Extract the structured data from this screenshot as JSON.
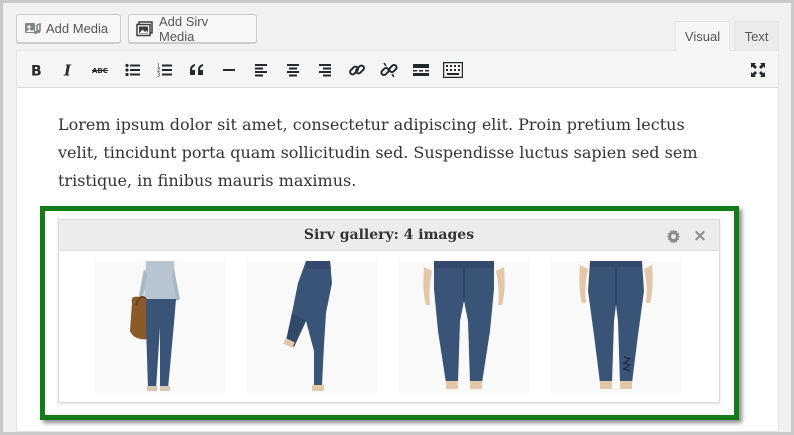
{
  "media_buttons": {
    "add_media": "Add Media",
    "add_sirv_media": "Add Sirv Media"
  },
  "tabs": {
    "visual": "Visual",
    "text": "Text",
    "active": "Visual"
  },
  "toolbar": {
    "buttons": [
      "bold-icon",
      "italic-icon",
      "strikethrough-icon",
      "bullet-list-icon",
      "numbered-list-icon",
      "blockquote-icon",
      "horizontal-rule-icon",
      "align-left-icon",
      "align-center-icon",
      "align-right-icon",
      "insert-link-icon",
      "remove-link-icon",
      "read-more-icon",
      "toolbar-toggle-icon",
      "fullscreen-icon"
    ]
  },
  "content": {
    "paragraph": "Lorem ipsum dolor sit amet, consectetur adipiscing elit. Proin pretium lectus velit, tincidunt porta quam sollicitudin sed. Suspendisse luctus sapien sed sem tristique, in finibus mauris maximus."
  },
  "gallery": {
    "title": "Sirv gallery: 4 images",
    "close_glyph": "×",
    "image_count": 4,
    "images": [
      "jeans-front-full-outfit",
      "jeans-side-view",
      "jeans-front-view",
      "jeans-back-view"
    ],
    "highlight_color": "#137b17"
  },
  "colors": {
    "denim": "#3a5478",
    "frame_background": "#f1f1f1",
    "toolbar_background": "#f5f5f5"
  }
}
